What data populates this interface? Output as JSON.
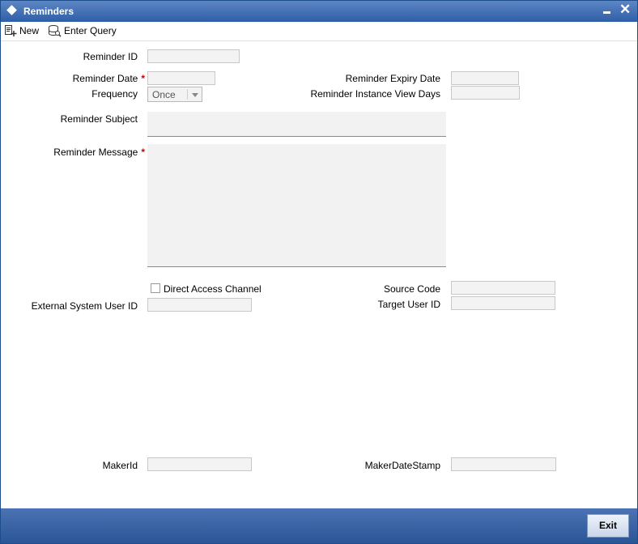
{
  "window": {
    "title": "Reminders",
    "icons": {
      "window": "diamond-icon",
      "minimize": "minimize-icon",
      "close": "close-icon"
    }
  },
  "toolbar": {
    "new_label": "New",
    "enter_query_label": "Enter Query",
    "icons": {
      "new": "new-document-icon",
      "enter_query": "query-icon"
    }
  },
  "form": {
    "reminder_id": {
      "label": "Reminder ID",
      "value": ""
    },
    "reminder_date": {
      "label": "Reminder Date",
      "required_mark": "*",
      "value": ""
    },
    "reminder_expiry_date": {
      "label": "Reminder Expiry Date",
      "value": ""
    },
    "frequency": {
      "label": "Frequency",
      "selected": "Once"
    },
    "reminder_instance_view_days": {
      "label": "Reminder Instance View Days",
      "value": ""
    },
    "reminder_subject": {
      "label": "Reminder Subject",
      "value": ""
    },
    "reminder_message": {
      "label": "Reminder Message",
      "required_mark": "*",
      "value": ""
    },
    "direct_access_channel": {
      "label": "Direct Access Channel",
      "checked": false
    },
    "source_code": {
      "label": "Source Code",
      "value": ""
    },
    "external_system_user_id": {
      "label": "External System User ID",
      "value": ""
    },
    "target_user_id": {
      "label": "Target User ID",
      "value": ""
    },
    "maker_id": {
      "label": "MakerId",
      "value": ""
    },
    "maker_date_stamp": {
      "label": "MakerDateStamp",
      "value": ""
    }
  },
  "footer": {
    "exit_label": "Exit"
  },
  "colors": {
    "titlebar": "#2f5fa7",
    "footer": "#2a5597",
    "required": "#cc0000",
    "field_bg": "#f3f3f3"
  }
}
